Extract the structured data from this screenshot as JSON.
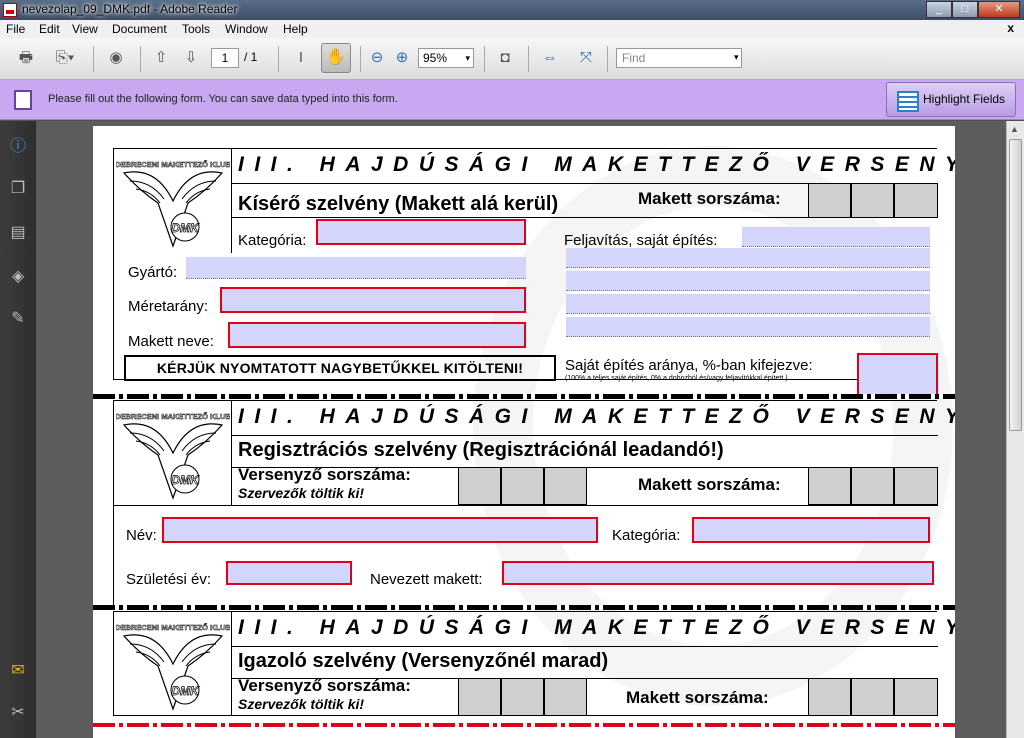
{
  "window": {
    "title": "nevezolap_09_DMK.pdf - Adobe Reader",
    "min": "_",
    "max": "□",
    "close": "✕"
  },
  "menu": [
    "File",
    "Edit",
    "View",
    "Document",
    "Tools",
    "Window",
    "Help"
  ],
  "menu_close": "x",
  "toolbar": {
    "page_current": "1",
    "page_total": "/ 1",
    "zoom": "95%",
    "find_placeholder": "Find"
  },
  "formbar": {
    "message": "Please fill out the following form. You can save data typed into this form.",
    "highlight_label": "Highlight Fields"
  },
  "logo_text": "DEBRECENI MAKETTEZŐ KLUB",
  "logo_badge": "DMK",
  "heading": "III. HAJDÚSÁGI MAKETTEZŐ VERSENY",
  "s1": {
    "title": "Kísérő szelvény (Makett alá kerül)",
    "makett_sorszama": "Makett sorszáma:",
    "kategoria": "Kategória:",
    "gyarto": "Gyártó:",
    "meretarany": "Méretarány:",
    "makett_neve": "Makett neve:",
    "feljavitas": "Feljavítás, saját építés:",
    "notice": "KÉRJÜK NYOMTATOTT NAGYBETŰKKEL KITÖLTENI!",
    "sajat": "Saját építés aránya, %-ban kifejezve:",
    "sajat_note": "(100% a teljes saját építés, 0% a dobozból és/vagy feljavítókkal épített.)"
  },
  "s2": {
    "title": "Regisztrációs szelvény (Regisztrációnál leadandó!)",
    "versenyzo": "Versenyző sorszáma:",
    "szervezok": "Szervezők töltik ki!",
    "makett_sorszama": "Makett sorszáma:",
    "nev": "Név:",
    "kategoria": "Kategória:",
    "szuletesi": "Születési év:",
    "nevezett": "Nevezett makett:"
  },
  "s3": {
    "title": "Igazoló szelvény (Versenyzőnél marad)",
    "versenyzo": "Versenyző sorszáma:",
    "szervezok": "Szervezők töltik ki!",
    "makett_sorszama": "Makett sorszáma:"
  }
}
